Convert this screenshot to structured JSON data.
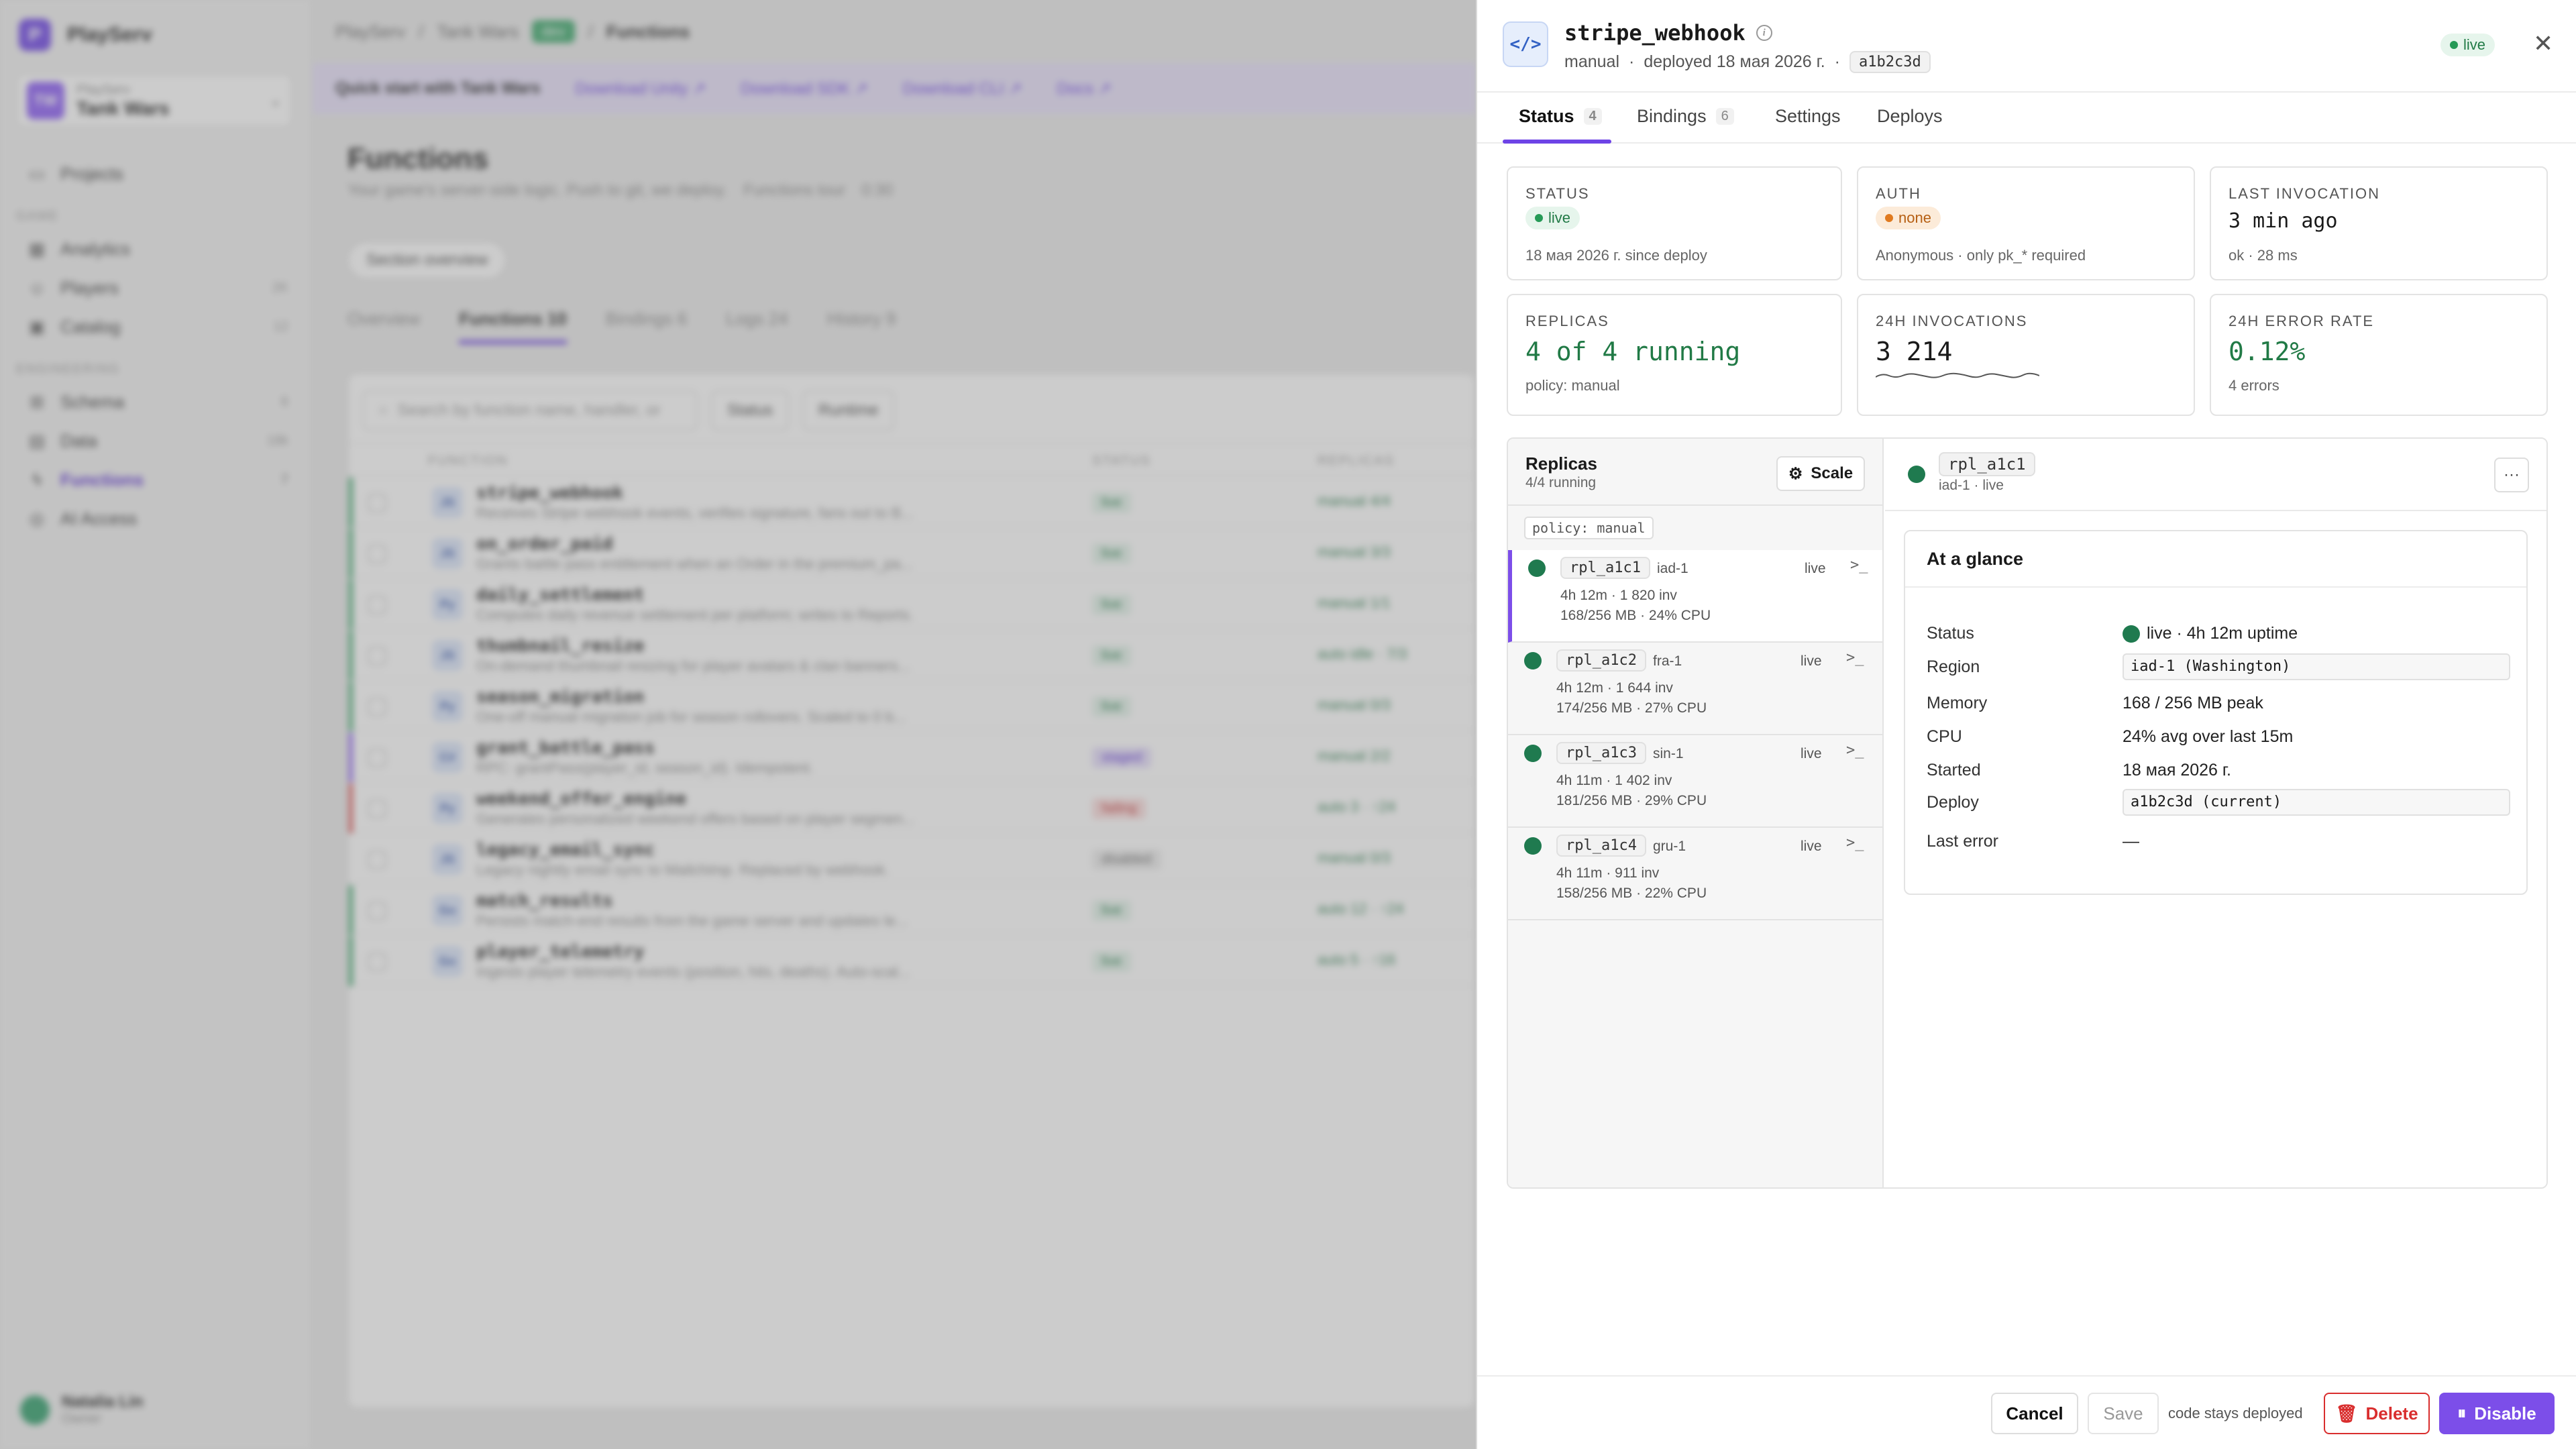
{
  "app": {
    "brand": "PlayServ",
    "brand_logo_letter": "P",
    "project_org": "PlayServ",
    "project_name": "Tank Wars",
    "project_avatar": "TW"
  },
  "sidebar": {
    "items": [
      {
        "label": "Projects",
        "icon": "folder-icon",
        "count": ""
      },
      {
        "label": "Analytics",
        "icon": "chart-icon",
        "count": ""
      },
      {
        "label": "Players",
        "icon": "user-icon",
        "count": "2K"
      },
      {
        "label": "Catalog",
        "icon": "box-icon",
        "count": "12"
      },
      {
        "label": "Schema",
        "icon": "schema-icon",
        "count": "6"
      },
      {
        "label": "Data",
        "icon": "database-icon",
        "count": "18k"
      },
      {
        "label": "Functions",
        "icon": "lightning-icon",
        "count": "7"
      },
      {
        "label": "AI Access",
        "icon": "globe-icon",
        "count": ""
      }
    ],
    "group_game": "GAME",
    "group_engineering": "ENGINEERING",
    "user_name": "Natalia Lin",
    "user_role": "Owner"
  },
  "background": {
    "breadcrumb": [
      "PlayServ",
      "Tank Wars"
    ],
    "env": "dev",
    "breadcrumb_current": "Functions",
    "banner_title": "Quick start with Tank Wars",
    "banner_links": [
      "Download Unity ↗",
      "Download SDK ↗",
      "Download CLI ↗",
      "Docs ↗"
    ],
    "page_title": "Functions",
    "page_subtitle": "Your game's server-side logic. Push to git, we deploy.",
    "tour_label": "Functions tour",
    "tour_time": "0:30",
    "section_overview": "Section overview",
    "tabs": [
      {
        "label": "Overview",
        "count": ""
      },
      {
        "label": "Functions",
        "count": "10"
      },
      {
        "label": "Bindings",
        "count": "6"
      },
      {
        "label": "Logs",
        "count": "24"
      },
      {
        "label": "History",
        "count": "9"
      }
    ],
    "search_placeholder": "Search by function name, handler, or",
    "filter_status": "Status",
    "filter_runtime": "Runtime",
    "col_function": "FUNCTION",
    "col_status": "STATUS",
    "col_replicas": "REPLICAS",
    "rows": [
      {
        "rt": "JS",
        "name": "stripe_webhook",
        "desc": "Receives Stripe webhook events, verifies signature, fans out to B...",
        "status": "live",
        "replicas": "manual  4/4"
      },
      {
        "rt": "JS",
        "name": "on_order_paid",
        "desc": "Grants battle pass entitlement when an Order in the premium_pa...",
        "status": "live",
        "replicas": "manual  3/3"
      },
      {
        "rt": "Py",
        "name": "daily_settlement",
        "desc": "Computes daily revenue settlement per platform; writes to Reports.",
        "status": "live",
        "replicas": "manual  1/1"
      },
      {
        "rt": "JS",
        "name": "thumbnail_resize",
        "desc": "On-demand thumbnail resizing for player avatars & clan banners...",
        "status": "live",
        "replicas": "auto  idle · 7/3"
      },
      {
        "rt": "Py",
        "name": "season_migration",
        "desc": "One-off manual migration job for season rollovers. Scaled to 0 b...",
        "status": "live",
        "replicas": "manual  0/3"
      },
      {
        "rt": "C#",
        "name": "grant_battle_pass",
        "desc": "RPC: grantPass(player_id, season_id). Idempotent.",
        "status": "staged",
        "replicas": "manual  2/2"
      },
      {
        "rt": "Py",
        "name": "weekend_offer_engine",
        "desc": "Generates personalized weekend offers based on player segmen...",
        "status": "failing",
        "replicas": "auto  3 · ↑24"
      },
      {
        "rt": "JS",
        "name": "legacy_email_sync",
        "desc": "Legacy nightly email sync to Mailchimp. Replaced by webhook.",
        "status": "disabled",
        "replicas": "manual  0/3"
      },
      {
        "rt": "Go",
        "name": "match_results",
        "desc": "Persists match-end results from the game server and updates le...",
        "status": "live",
        "replicas": "auto  12 · ↑24"
      },
      {
        "rt": "Go",
        "name": "player_telemetry",
        "desc": "Ingests player telemetry events (position, hits, deaths). Auto-scal...",
        "status": "live",
        "replicas": "auto  5 · ↑16"
      }
    ]
  },
  "drawer": {
    "title": "stripe_webhook",
    "meta_policy": "manual",
    "meta_deployed": "deployed 18 мая 2026 г.",
    "meta_commit": "a1b2c3d",
    "status_pill": "live",
    "tabs": [
      {
        "label": "Status",
        "count": "4"
      },
      {
        "label": "Bindings",
        "count": "6"
      },
      {
        "label": "Settings",
        "count": ""
      },
      {
        "label": "Deploys",
        "count": ""
      }
    ],
    "cards": {
      "status": {
        "label": "STATUS",
        "value": "live",
        "sub": "18 мая 2026 г. since deploy"
      },
      "auth": {
        "label": "AUTH",
        "value": "none",
        "sub": "Anonymous · only pk_* required"
      },
      "last_invocation": {
        "label": "LAST INVOCATION",
        "value": "3 min ago",
        "sub": "ok · 28 ms"
      },
      "replicas": {
        "label": "REPLICAS",
        "value": "4 of 4 running",
        "sub": "policy: manual"
      },
      "invocations": {
        "label": "24H INVOCATIONS",
        "value": "3 214"
      },
      "error_rate": {
        "label": "24H ERROR RATE",
        "value": "0.12%",
        "sub": "4 errors"
      }
    },
    "replicas_panel": {
      "title": "Replicas",
      "sub": "4/4 running",
      "scale_label": "Scale",
      "policy": "policy: manual",
      "items": [
        {
          "id": "rpl_a1c1",
          "region": "iad-1",
          "state": "live",
          "line1": "4h 12m · 1 820 inv",
          "line2": "168/256 MB · 24% CPU"
        },
        {
          "id": "rpl_a1c2",
          "region": "fra-1",
          "state": "live",
          "line1": "4h 12m · 1 644 inv",
          "line2": "174/256 MB · 27% CPU"
        },
        {
          "id": "rpl_a1c3",
          "region": "sin-1",
          "state": "live",
          "line1": "4h 11m · 1 402 inv",
          "line2": "181/256 MB · 29% CPU"
        },
        {
          "id": "rpl_a1c4",
          "region": "gru-1",
          "state": "live",
          "line1": "4h 11m · 911 inv",
          "line2": "158/256 MB · 22% CPU"
        }
      ]
    },
    "detail": {
      "id": "rpl_a1c1",
      "sub": "iad-1 · live",
      "more_label": "···",
      "glance_title": "At a glance",
      "rows": [
        {
          "key": "Status",
          "value": "live · 4h 12m uptime"
        },
        {
          "key": "Region",
          "value": "iad-1 (Washington)"
        },
        {
          "key": "Memory",
          "value": "168 / 256 MB peak"
        },
        {
          "key": "CPU",
          "value": "24% avg over last 15m"
        },
        {
          "key": "Started",
          "value": "18 мая 2026 г."
        },
        {
          "key": "Deploy",
          "value": "a1b2c3d (current)"
        },
        {
          "key": "Last error",
          "value": "—"
        }
      ]
    },
    "footer": {
      "cancel": "Cancel",
      "save": "Save",
      "note": "code stays deployed",
      "delete": "Delete",
      "disable": "Disable"
    }
  }
}
